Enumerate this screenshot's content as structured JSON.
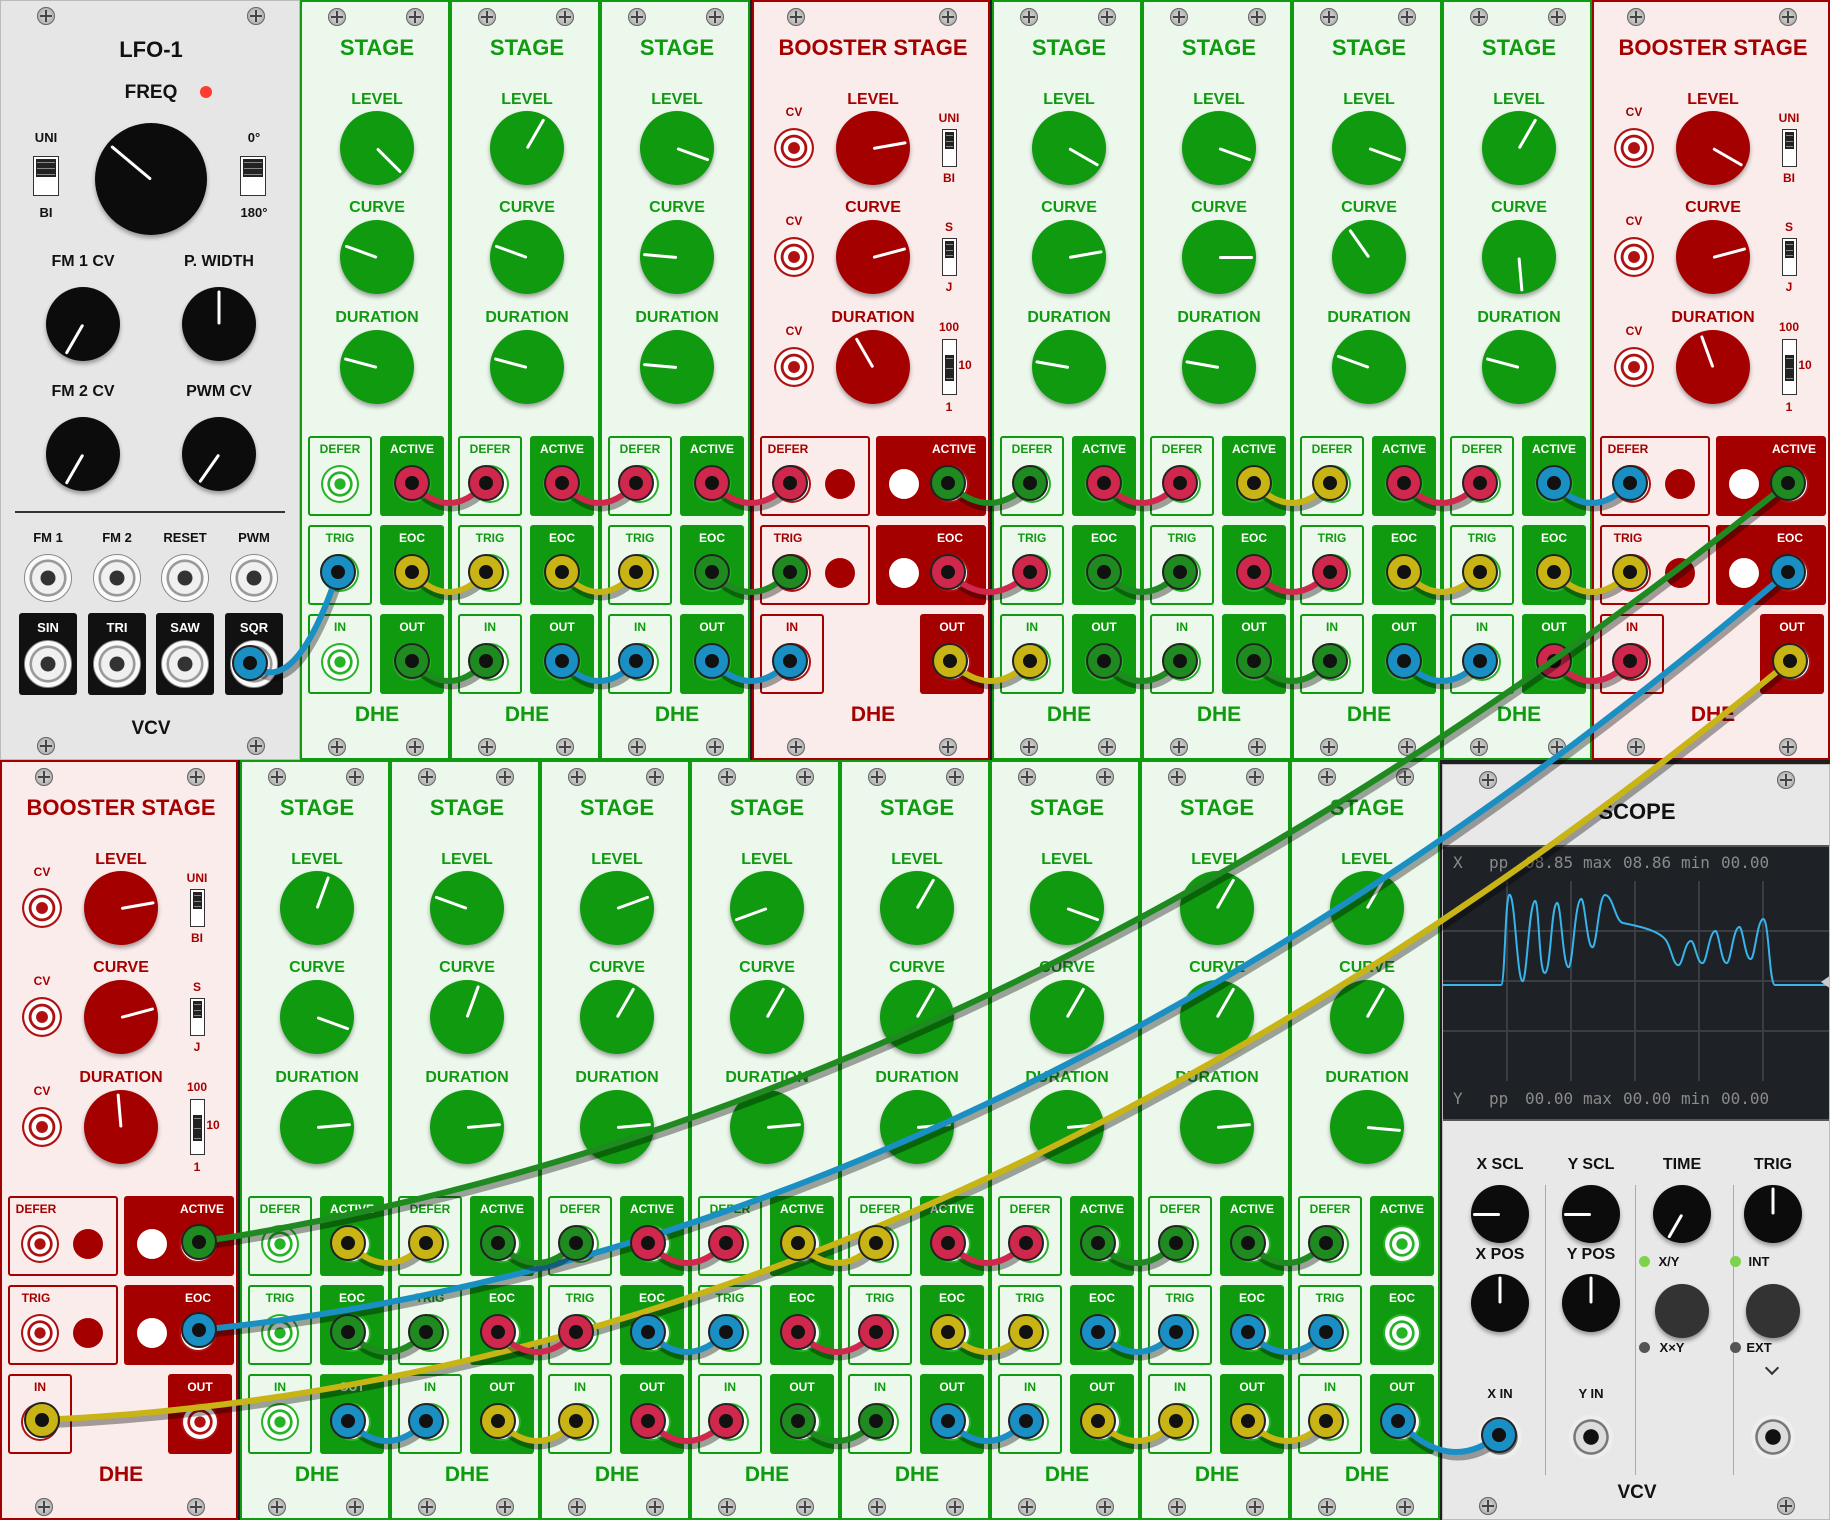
{
  "lfo": {
    "title": "LFO-1",
    "freq_label": "FREQ",
    "uni_label": "UNI",
    "bi_label": "BI",
    "phase0_label": "0°",
    "phase180_label": "180°",
    "fm1cv_label": "FM 1 CV",
    "pwidth_label": "P. WIDTH",
    "fm2cv_label": "FM 2 CV",
    "pwmcv_label": "PWM CV",
    "inputs": [
      "FM 1",
      "FM 2",
      "RESET",
      "PWM"
    ],
    "outputs": [
      "SIN",
      "TRI",
      "SAW",
      "SQR"
    ],
    "brand": "VCV"
  },
  "stage": {
    "title": "STAGE",
    "level": "LEVEL",
    "curve": "CURVE",
    "duration": "DURATION",
    "defer": "DEFER",
    "active": "ACTIVE",
    "trig": "TRIG",
    "eoc": "EOC",
    "in": "IN",
    "out": "OUT",
    "brand": "DHE"
  },
  "booster": {
    "title": "BOOSTER STAGE",
    "cv": "CV",
    "uni": "UNI",
    "bi": "BI",
    "s": "S",
    "j": "J",
    "r100": "100",
    "r10": "10",
    "r1": "1"
  },
  "scope": {
    "title": "SCOPE",
    "x_readout": {
      "axis": "X",
      "pp_label": "pp",
      "pp": "08.85",
      "max_label": "max",
      "max": "08.86",
      "min_label": "min",
      "min": "00.00"
    },
    "y_readout": {
      "axis": "Y",
      "pp_label": "pp",
      "pp": "00.00",
      "max_label": "max",
      "max": "00.00",
      "min_label": "min",
      "min": "00.00"
    },
    "xscl": "X SCL",
    "yscl": "Y SCL",
    "time": "TIME",
    "trig": "TRIG",
    "xpos": "X POS",
    "ypos": "Y POS",
    "xy": "X/Y",
    "xmy": "X×Y",
    "int": "INT",
    "ext": "EXT",
    "xin": "X IN",
    "yin": "Y IN",
    "brand": "VCV"
  },
  "colors": {
    "rack_rail": "#1f1f1f",
    "stage_panel": "#ecf8ec",
    "stage_accent": "#0f9a0f",
    "booster_panel": "#fbecec",
    "booster_accent": "#a50000",
    "cable_red": "#d0284c",
    "cable_yellow": "#c8b414",
    "cable_green": "#1f8a1f",
    "cable_blue": "#1a8fc4",
    "scope_trace": "#37b4ea",
    "led_red": "#ff3b30",
    "led_green": "#7fd24b"
  }
}
